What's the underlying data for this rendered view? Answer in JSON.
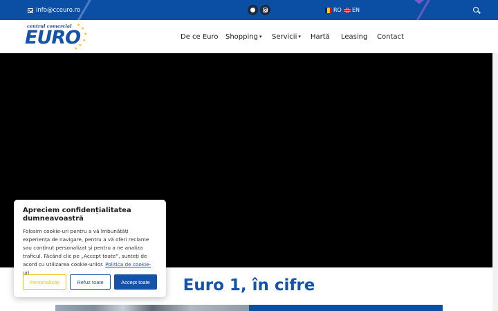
{
  "topbar": {
    "email": "info@cceuro.ro",
    "social": [
      {
        "icon": "facebook-icon"
      },
      {
        "icon": "instagram-icon"
      }
    ],
    "languages": [
      {
        "code": "RO",
        "flag_colors": [
          "#002b7f",
          "#fcd116",
          "#ce1126"
        ]
      },
      {
        "code": "EN"
      }
    ],
    "background_color": "#0a4fa3"
  },
  "header": {
    "logo": {
      "tagline": "centrul comercial",
      "name": "EURO"
    },
    "nav": [
      {
        "label": "De ce Euro",
        "has_dropdown": false
      },
      {
        "label": "Shopping",
        "has_dropdown": true
      },
      {
        "label": "Servicii",
        "has_dropdown": true
      },
      {
        "label": "Hartă",
        "has_dropdown": false
      },
      {
        "label": "Leasing",
        "has_dropdown": false
      },
      {
        "label": "Contact",
        "has_dropdown": false
      }
    ],
    "caret": "▾"
  },
  "hero": {
    "background_color": "#000000"
  },
  "section": {
    "title": "Euro 1, în cifre"
  },
  "cookie_banner": {
    "title": "Apreciem confidențialitatea dumneavoastră",
    "text": "Folosim cookie-uri pentru a vă îmbunătăți experiența de navigare, pentru a vă oferi reclame sau conținut personalizat și pentru a ne analiza traficul. Făcând clic pe „Accept toate”, sunteți de acord cu utilizarea cookie-urilor.",
    "policy_link": "Politica de cookie-uri",
    "buttons": {
      "customize": "Personalizați",
      "reject": "Refuz toate",
      "accept": "Accept toate"
    },
    "accent_color": "#1553a8",
    "customize_color": "#f2c313"
  }
}
